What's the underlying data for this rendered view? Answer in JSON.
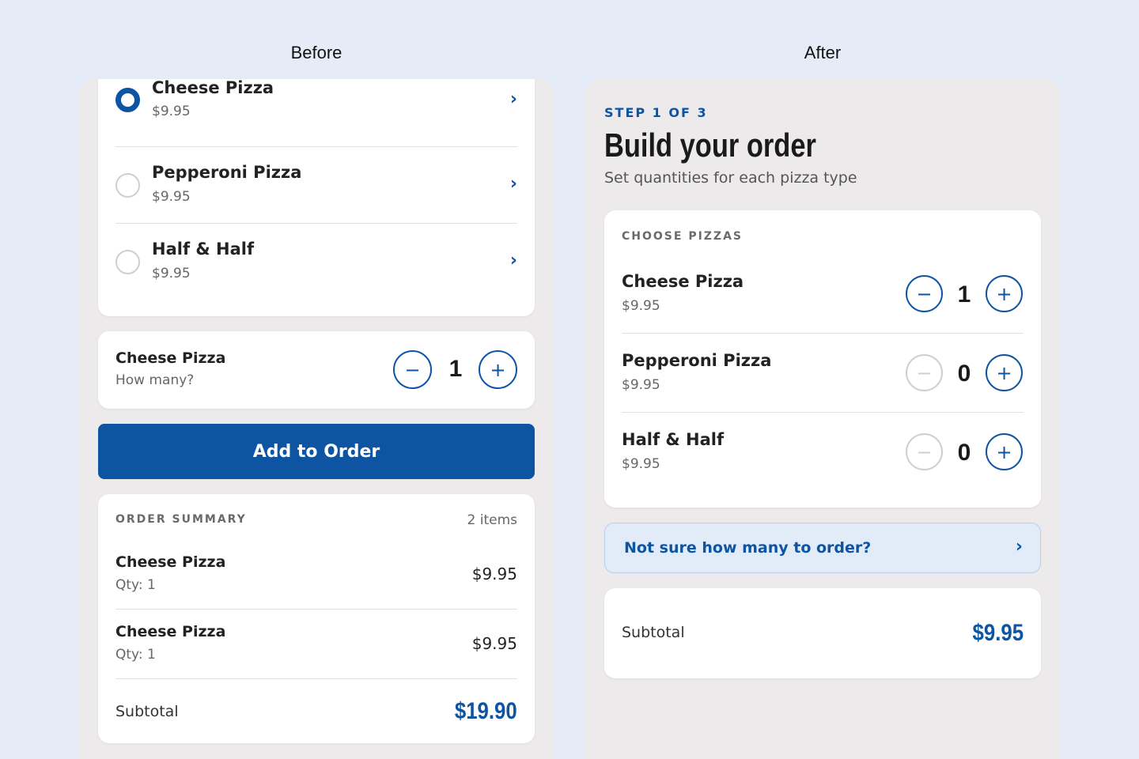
{
  "labels": {
    "before": "Before",
    "after": "After"
  },
  "before": {
    "pizzas": [
      {
        "name": "Cheese Pizza",
        "price": "$9.95",
        "selected": true
      },
      {
        "name": "Pepperoni Pizza",
        "price": "$9.95",
        "selected": false
      },
      {
        "name": "Half & Half",
        "price": "$9.95",
        "selected": false
      }
    ],
    "quantity_card": {
      "name": "Cheese Pizza",
      "prompt": "How many?",
      "minus": "−",
      "value": "1",
      "plus": "+"
    },
    "add_button": "Add to Order",
    "summary": {
      "heading": "ORDER SUMMARY",
      "count": "2 items",
      "lines": [
        {
          "name": "Cheese Pizza",
          "qty": "Qty: 1",
          "price": "$9.95"
        },
        {
          "name": "Cheese Pizza",
          "qty": "Qty: 1",
          "price": "$9.95"
        }
      ],
      "subtotal_label": "Subtotal",
      "subtotal_value": "$19.90"
    }
  },
  "after": {
    "step": "STEP 1 OF 3",
    "title": "Build your order",
    "subtitle": "Set quantities for each pizza type",
    "choose_heading": "CHOOSE PIZZAS",
    "pizzas": [
      {
        "name": "Cheese Pizza",
        "price": "$9.95",
        "qty": "1",
        "minus_disabled": false
      },
      {
        "name": "Pepperoni Pizza",
        "price": "$9.95",
        "qty": "0",
        "minus_disabled": true
      },
      {
        "name": "Half & Half",
        "price": "$9.95",
        "qty": "0",
        "minus_disabled": true
      }
    ],
    "minus": "−",
    "plus": "+",
    "help": "Not sure how many to order?",
    "subtotal_label": "Subtotal",
    "subtotal_value": "$9.95"
  },
  "icons": {
    "chevron": "›"
  },
  "colors": {
    "brand": "#0d54a2",
    "background": "#e6ecf7",
    "panel": "#edeaec"
  }
}
